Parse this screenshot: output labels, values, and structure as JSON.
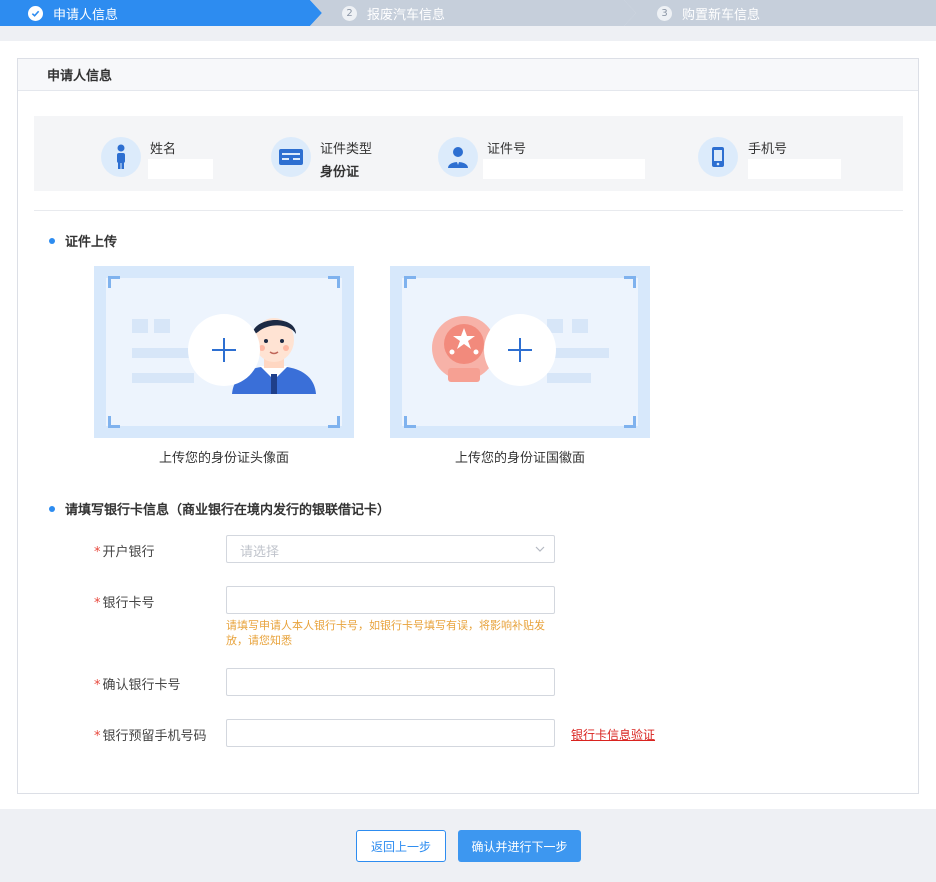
{
  "stepper": {
    "steps": [
      {
        "num": "✓",
        "label": "申请人信息"
      },
      {
        "num": "2",
        "label": "报废汽车信息"
      },
      {
        "num": "3",
        "label": "购置新车信息"
      }
    ]
  },
  "panel": {
    "title": "申请人信息",
    "info": {
      "name_label": "姓名",
      "name_value": "",
      "id_type_label": "证件类型",
      "id_type_value": "身份证",
      "id_number_label": "证件号",
      "id_number_value": "",
      "phone_label": "手机号",
      "phone_value": ""
    },
    "upload_section": {
      "title": "证件上传",
      "front_caption": "上传您的身份证头像面",
      "back_caption": "上传您的身份证国徽面"
    },
    "bank_section": {
      "title": "请填写银行卡信息（商业银行在境内发行的银联借记卡）",
      "required_mark": "*",
      "bank_label": "开户银行",
      "bank_placeholder": "请选择",
      "card_label": "银行卡号",
      "card_value": "",
      "card_hint": "请填写申请人本人银行卡号，如银行卡号填写有误，将影响补贴发放，请您知悉",
      "confirm_label": "确认银行卡号",
      "confirm_value": "",
      "phone_label": "银行预留手机号码",
      "phone_value": "",
      "verify_link": "银行卡信息验证"
    }
  },
  "footer": {
    "back_label": "返回上一步",
    "next_label": "确认并进行下一步"
  },
  "colors": {
    "primary": "#2d8cf0",
    "inactive_step": "#c6cfdb",
    "required": "#e8473c",
    "hint": "#e8a33c",
    "link": "#d9231f"
  }
}
